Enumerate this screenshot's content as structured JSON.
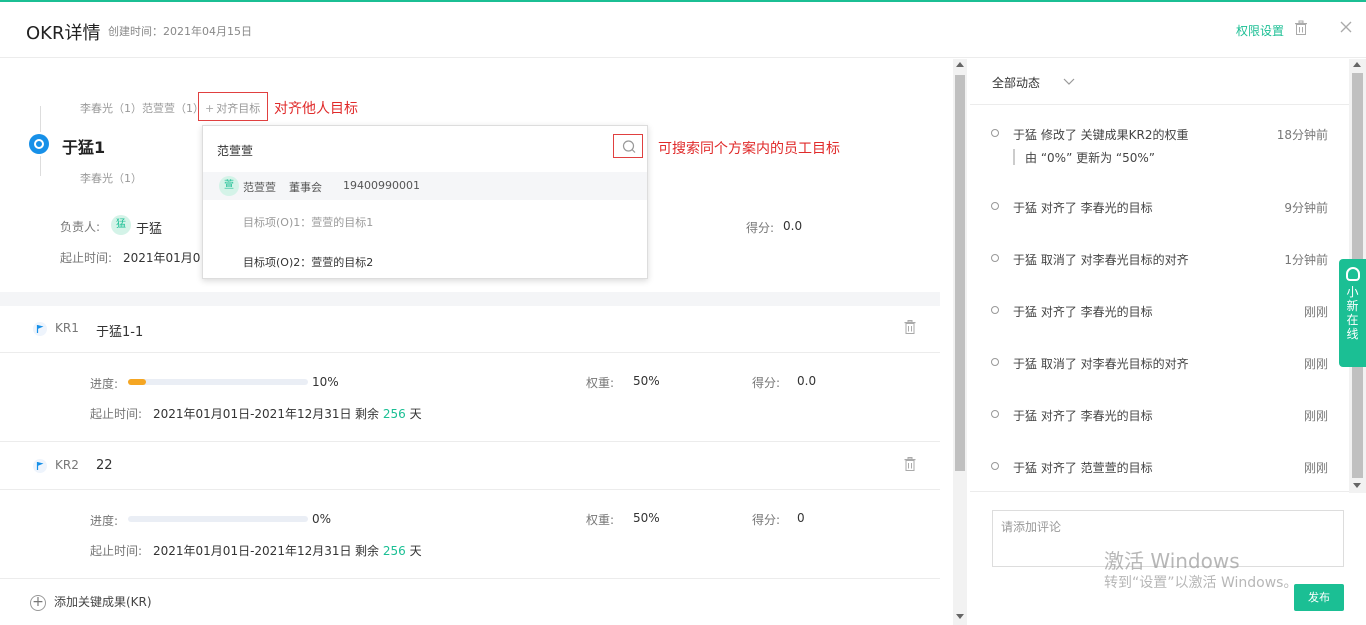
{
  "header": {
    "title": "OKR详情",
    "created": "创建时间：2021年04月15日",
    "permission": "权限设置",
    "accent": "#1bbf94"
  },
  "objective": {
    "align_top": "李春光（1）范萱萱（1）",
    "align_button": "对齐目标",
    "align_note": "对齐他人目标",
    "name": "于猛1",
    "align_bottom": "李春光（1）",
    "owner_label": "负责人:",
    "owner_avatar": "猛",
    "owner_name": "于猛",
    "period_label": "起止时间:",
    "period_value": "2021年01月0",
    "score_label": "得分:",
    "score_value": "0.0"
  },
  "dropdown": {
    "search_value": "范萱萱",
    "search_note": "可搜索同个方案内的员工目标",
    "person": {
      "avatar": "萱",
      "name": "范萱萱",
      "dept": "董事会",
      "phone": "19400990001"
    },
    "objectives": [
      "目标项(O)1：萱萱的目标1",
      "目标项(O)2：萱萱的目标2"
    ]
  },
  "krs": [
    {
      "code": "KR1",
      "name": "于猛1-1",
      "progress_label": "进度:",
      "progress": 10,
      "progress_text": "10%",
      "weight_label": "权重:",
      "weight": "50%",
      "score_label": "得分:",
      "score": "0.0",
      "period_label": "起止时间:",
      "period": "2021年01月01日-2021年12月31日",
      "remain_prefix": "剩余",
      "remain_days": "256",
      "remain_suffix": "天"
    },
    {
      "code": "KR2",
      "name": "22",
      "progress_label": "进度:",
      "progress": 0,
      "progress_text": "0%",
      "weight_label": "权重:",
      "weight": "50%",
      "score_label": "得分:",
      "score": "0",
      "period_label": "起止时间:",
      "period": "2021年01月01日-2021年12月31日",
      "remain_prefix": "剩余",
      "remain_days": "256",
      "remain_suffix": "天"
    }
  ],
  "add_kr": "添加关键成果(KR)",
  "feed": {
    "title": "全部动态",
    "items": [
      {
        "text": "于猛 修改了 关键成果KR2的权重",
        "time": "18分钟前",
        "detail": "由 “0%” 更新为 “50%”"
      },
      {
        "text": "于猛 对齐了 李春光的目标",
        "time": "9分钟前"
      },
      {
        "text": "于猛 取消了 对李春光目标的对齐",
        "time": "1分钟前"
      },
      {
        "text": "于猛 对齐了 李春光的目标",
        "time": "刚刚"
      },
      {
        "text": "于猛 取消了 对李春光目标的对齐",
        "time": "刚刚"
      },
      {
        "text": "于猛 对齐了 李春光的目标",
        "time": "刚刚"
      },
      {
        "text": "于猛 对齐了 范萱萱的目标",
        "time": "刚刚"
      }
    ],
    "comment_placeholder": "请添加评论",
    "publish": "发布"
  },
  "watermark": {
    "line1": "激活 Windows",
    "line2": "转到“设置”以激活 Windows。"
  },
  "online": "小新在线"
}
